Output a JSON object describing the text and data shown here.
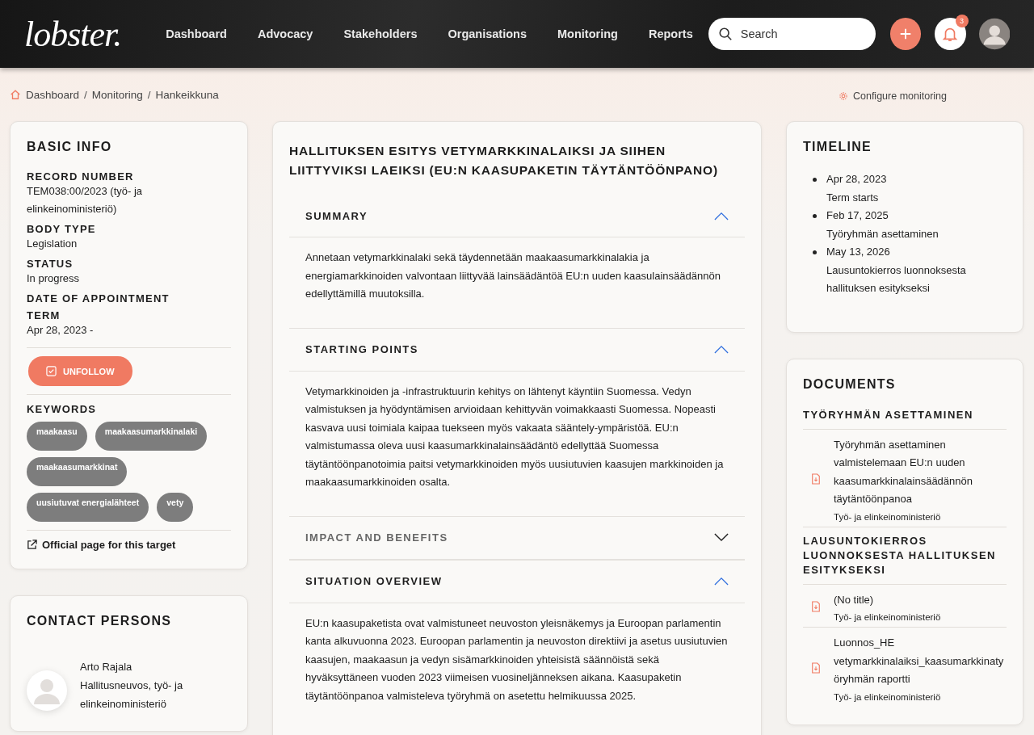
{
  "header": {
    "logo": "lobster.",
    "nav": [
      {
        "label": "Dashboard",
        "selected": false
      },
      {
        "label": "Advocacy",
        "selected": false
      },
      {
        "label": "Stakeholders",
        "selected": false
      },
      {
        "label": "Organisations",
        "selected": false
      },
      {
        "label": "Monitoring",
        "selected": false
      },
      {
        "label": "Reports",
        "selected": false
      }
    ],
    "search": {
      "placeholder": "Search"
    },
    "notifications": "3"
  },
  "breadcrumb": {
    "items": [
      "Dashboard",
      "Monitoring",
      "Hankeikkuna"
    ],
    "separator": "/"
  },
  "configure": "Configure monitoring",
  "basic_info": {
    "title": "BASIC INFO",
    "fields": [
      {
        "label": "RECORD NUMBER",
        "value": "TEM038:00/2023 (työ- ja elinkeinoministeriö)"
      },
      {
        "label": "BODY TYPE",
        "value": "Legislation"
      },
      {
        "label": "STATUS",
        "value": "In progress"
      },
      {
        "label": "DATE OF APPOINTMENT"
      },
      {
        "label": "TERM",
        "value": "Apr 28, 2023 -"
      }
    ],
    "follow_button": {
      "label": "UNFOLLOW",
      "checked": true
    },
    "keywords_title": "KEYWORDS",
    "keywords": [
      "maakaasu",
      "maakaasumarkkinalaki",
      "maakaasumarkkinat",
      "uusiutuvat energialähteet",
      "vety"
    ],
    "official_link": "Official page for this target"
  },
  "contacts": {
    "title": "CONTACT PERSONS",
    "people": [
      {
        "name": "Arto Rajala",
        "role": "Hallitusneuvos, työ- ja elinkeinoministeriö"
      }
    ]
  },
  "main": {
    "title": "HALLITUKSEN ESITYS VETYMARKKINALAIKSI JA SIIHEN LIITTYVIKSI LAEIKSI (EU:N KAASUPAKETIN TÄYTÄNTÖÖNPANO)",
    "sections": [
      {
        "title": "SUMMARY",
        "expanded": true,
        "text": "Annetaan vetymarkkinalaki sekä täydennetään maakaasumarkkinalakia ja energiamarkkinoiden valvontaan liittyvää lainsäädäntöä EU:n uuden kaasulainsäädännön edellyttämillä muutoksilla."
      },
      {
        "title": "STARTING POINTS",
        "expanded": true,
        "text": "Vetymarkkinoiden ja -infrastruktuurin kehitys on lähtenyt käyntiin Suomessa. Vedyn valmistuksen ja hyödyntämisen arvioidaan kehittyvän voimakkaasti Suomessa. Nopeasti kasvava uusi toimiala kaipaa tuekseen myös vakaata sääntely-ympäristöä. EU:n valmistumassa oleva uusi kaasumarkkinalainsäädäntö edellyttää Suomessa täytäntöönpanotoimia paitsi vetymarkkinoiden myös uusiutuvien kaasujen markkinoiden ja maakaasumarkkinoiden osalta."
      },
      {
        "title": "IMPACT AND BENEFITS",
        "expanded": false
      },
      {
        "title": "SITUATION OVERVIEW",
        "expanded": true,
        "text": "EU:n kaasupaketista ovat valmistuneet neuvoston yleisnäkemys ja Euroopan parlamentin kanta alkuvuonna 2023. Euroopan parlamentin ja neuvoston direktiivi ja asetus uusiutuvien kaasujen, maakaasun ja vedyn sisämarkkinoiden yhteisistä säännöistä sekä hyväksyttäneen vuoden 2023 viimeisen vuosineljänneksen aikana. Kaasupaketin täytäntöönpanoa valmisteleva työryhmä on asetettu helmikuussa 2025."
      }
    ]
  },
  "timeline": {
    "title": "TIMELINE",
    "events": [
      {
        "date": "Apr 28, 2023",
        "label": "Term starts"
      },
      {
        "date": "Feb 17, 2025",
        "label": "Työryhmän asettaminen"
      },
      {
        "date": "May 13, 2026",
        "label": "Lausuntokierros luonnoksesta hallituksen esitykseksi"
      }
    ]
  },
  "documents": {
    "title": "DOCUMENTS",
    "groups": [
      {
        "title": "TYÖRYHMÄN ASETTAMINEN",
        "items": [
          {
            "name": "Työryhmän asettaminen valmistelemaan EU:n uuden kaasumarkkinalainsäädännön täytäntöönpanoa",
            "source": "Työ- ja elinkeinoministeriö"
          }
        ]
      },
      {
        "title": "LAUSUNTOKIERROS LUONNOKSESTA HALLITUKSEN ESITYKSEKSI",
        "items": [
          {
            "name": "(No title)",
            "source": "Työ- ja elinkeinoministeriö"
          },
          {
            "name": "Luonnos_HE vetymarkkinalaiksi_kaasumarkkinatyöryhmän raportti",
            "source": "Työ- ja elinkeinoministeriö"
          }
        ]
      }
    ]
  }
}
